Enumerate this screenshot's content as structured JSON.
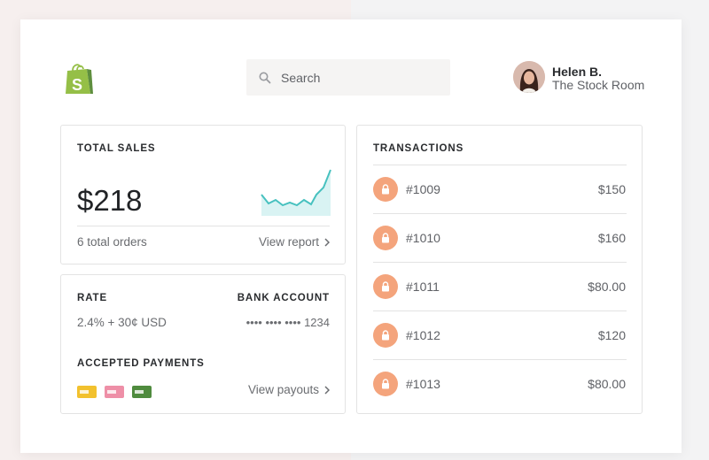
{
  "search": {
    "placeholder": "Search"
  },
  "user": {
    "name": "Helen B.",
    "store": "The Stock Room"
  },
  "total_sales": {
    "title": "TOTAL SALES",
    "amount": "$218",
    "orders": "6 total orders",
    "link_label": "View report"
  },
  "rate_card": {
    "rate_title": "RATE",
    "rate_value": "2.4% + 30¢ USD",
    "bank_title": "BANK ACCOUNT",
    "bank_value": "•••• •••• •••• 1234",
    "payments_title": "ACCEPTED PAYMENTS",
    "payment_icons": [
      "yellow-card-icon",
      "pink-card-icon",
      "green-card-icon"
    ],
    "payment_colors": [
      "#f2c12e",
      "#ee8fa7",
      "#4f8b3e"
    ],
    "link_label": "View payouts"
  },
  "transactions": {
    "title": "TRANSACTIONS",
    "rows": [
      {
        "id": "#1009",
        "amount": "$150"
      },
      {
        "id": "#1010",
        "amount": "$160"
      },
      {
        "id": "#1011",
        "amount": "$80.00"
      },
      {
        "id": "#1012",
        "amount": "$120"
      },
      {
        "id": "#1013",
        "amount": "$80.00"
      }
    ]
  },
  "colors": {
    "brand": "#95bf47",
    "sparkline": "#47c1bf",
    "lock": "#f4a47c"
  }
}
